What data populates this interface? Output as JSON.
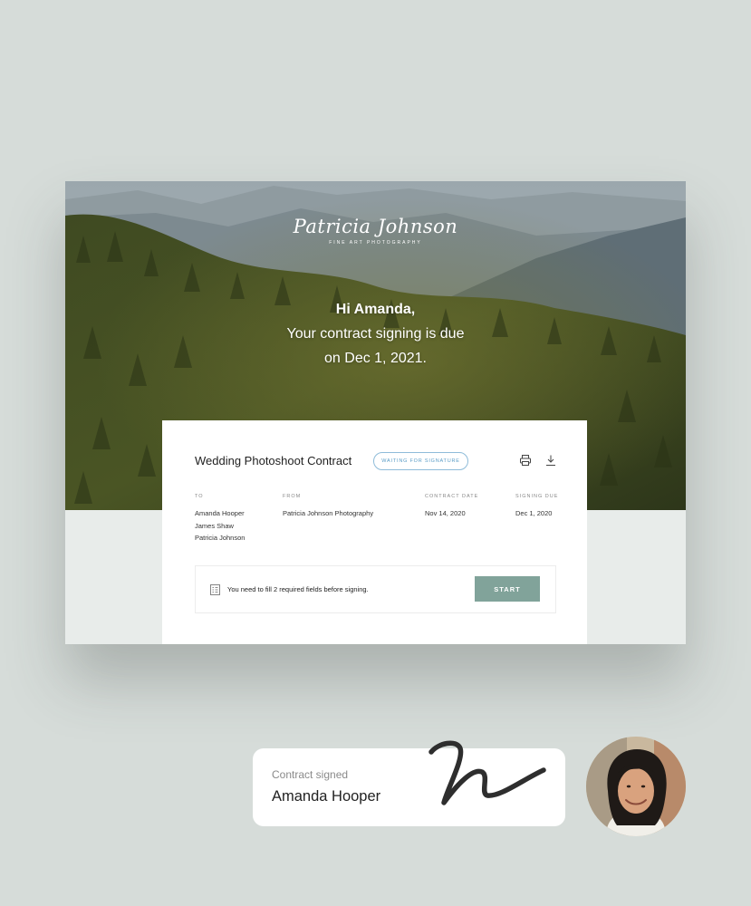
{
  "hero": {
    "logo_script": "Patricia Johnson",
    "logo_sub": "FINE ART     PHOTOGRAPHY",
    "greeting_name": "Hi Amanda,",
    "greeting_line1": "Your contract signing is due",
    "greeting_line2": "on Dec 1, 2021."
  },
  "contract": {
    "title": "Wedding Photoshoot Contract",
    "status_badge": "WAITING FOR SIGNATURE",
    "columns": [
      {
        "header": "TO",
        "values": [
          "Amanda Hooper",
          "James Shaw",
          "Patricia Johnson"
        ]
      },
      {
        "header": "FROM",
        "values": [
          "Patricia Johnson Photography"
        ]
      },
      {
        "header": "CONTRACT DATE",
        "values": [
          "Nov 14, 2020"
        ]
      },
      {
        "header": "SIGNING DUE",
        "values": [
          "Dec 1, 2020"
        ]
      }
    ],
    "notice_text": "You need to fill 2 required fields before signing.",
    "start_label": "START"
  },
  "signed": {
    "label": "Contract signed",
    "name": "Amanda Hooper"
  },
  "icons": [
    "print-icon",
    "download-icon",
    "form-icon",
    "signature-scribble",
    "avatar-photo"
  ],
  "colors": {
    "background": "#d6dcd9",
    "accent": "#81a39a",
    "badge": "#5a9cc6"
  }
}
